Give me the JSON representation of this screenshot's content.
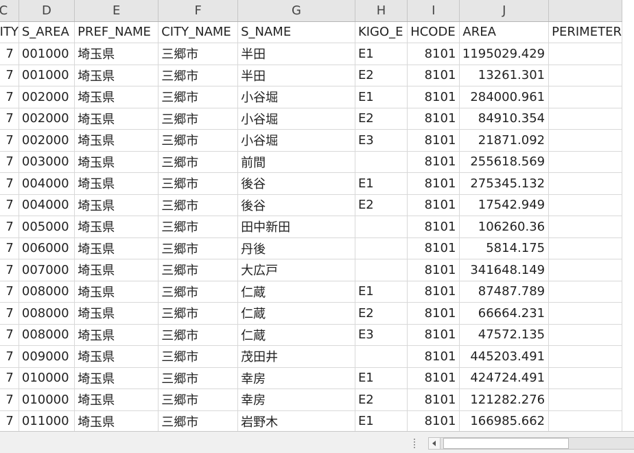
{
  "column_letters": [
    "C",
    "D",
    "E",
    "F",
    "G",
    "H",
    "I",
    "J",
    ""
  ],
  "field_names": [
    "CITY",
    "S_AREA",
    "PREF_NAME",
    "CITY_NAME",
    "S_NAME",
    "KIGO_E",
    "HCODE",
    "AREA",
    "PERIMETER"
  ],
  "rows": [
    [
      "7",
      "001000",
      "埼玉県",
      "三郷市",
      "半田",
      "E1",
      "8101",
      "1195029.429",
      ""
    ],
    [
      "7",
      "001000",
      "埼玉県",
      "三郷市",
      "半田",
      "E2",
      "8101",
      "13261.301",
      ""
    ],
    [
      "7",
      "002000",
      "埼玉県",
      "三郷市",
      "小谷堀",
      "E1",
      "8101",
      "284000.961",
      ""
    ],
    [
      "7",
      "002000",
      "埼玉県",
      "三郷市",
      "小谷堀",
      "E2",
      "8101",
      "84910.354",
      ""
    ],
    [
      "7",
      "002000",
      "埼玉県",
      "三郷市",
      "小谷堀",
      "E3",
      "8101",
      "21871.092",
      ""
    ],
    [
      "7",
      "003000",
      "埼玉県",
      "三郷市",
      "前間",
      "",
      "8101",
      "255618.569",
      ""
    ],
    [
      "7",
      "004000",
      "埼玉県",
      "三郷市",
      "後谷",
      "E1",
      "8101",
      "275345.132",
      ""
    ],
    [
      "7",
      "004000",
      "埼玉県",
      "三郷市",
      "後谷",
      "E2",
      "8101",
      "17542.949",
      ""
    ],
    [
      "7",
      "005000",
      "埼玉県",
      "三郷市",
      "田中新田",
      "",
      "8101",
      "106260.36",
      ""
    ],
    [
      "7",
      "006000",
      "埼玉県",
      "三郷市",
      "丹後",
      "",
      "8101",
      "5814.175",
      ""
    ],
    [
      "7",
      "007000",
      "埼玉県",
      "三郷市",
      "大広戸",
      "",
      "8101",
      "341648.149",
      ""
    ],
    [
      "7",
      "008000",
      "埼玉県",
      "三郷市",
      "仁蔵",
      "E1",
      "8101",
      "87487.789",
      ""
    ],
    [
      "7",
      "008000",
      "埼玉県",
      "三郷市",
      "仁蔵",
      "E2",
      "8101",
      "66664.231",
      ""
    ],
    [
      "7",
      "008000",
      "埼玉県",
      "三郷市",
      "仁蔵",
      "E3",
      "8101",
      "47572.135",
      ""
    ],
    [
      "7",
      "009000",
      "埼玉県",
      "三郷市",
      "茂田井",
      "",
      "8101",
      "445203.491",
      ""
    ],
    [
      "7",
      "010000",
      "埼玉県",
      "三郷市",
      "幸房",
      "E1",
      "8101",
      "424724.491",
      ""
    ],
    [
      "7",
      "010000",
      "埼玉県",
      "三郷市",
      "幸房",
      "E2",
      "8101",
      "121282.276",
      ""
    ],
    [
      "7",
      "011000",
      "埼玉県",
      "三郷市",
      "岩野木",
      "E1",
      "8101",
      "166985.662",
      ""
    ]
  ],
  "scrollbar_icons": {
    "left": "scroll-left-arrow-icon",
    "grip": "sheet-split-grip-icon"
  }
}
